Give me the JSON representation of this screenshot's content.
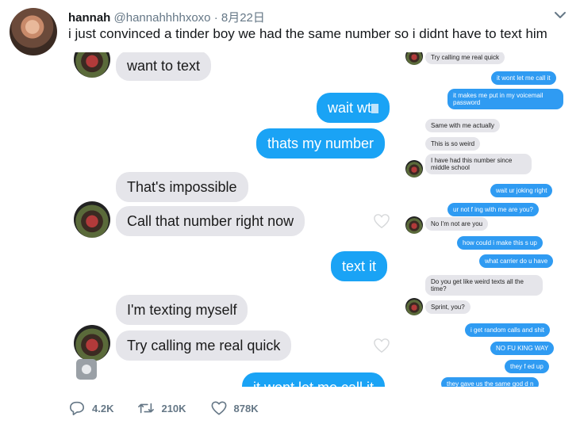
{
  "tweet": {
    "display_name": "hannah",
    "handle": "@hannahhhhxoxo",
    "separator": "·",
    "date": "8月22日",
    "text": "i just convinced a tinder boy we had the same number so i didnt have to text him"
  },
  "left_chat": [
    {
      "dir": "in",
      "text": "want to text"
    },
    {
      "dir": "out",
      "text": "wait wt"
    },
    {
      "dir": "out",
      "text": "thats my number"
    },
    {
      "dir": "in",
      "text": "That's impossible"
    },
    {
      "dir": "in",
      "text": "Call that number right now"
    },
    {
      "dir": "out",
      "text": "text it"
    },
    {
      "dir": "in",
      "text": "I'm texting myself"
    },
    {
      "dir": "in",
      "text": "Try calling me real quick"
    },
    {
      "dir": "out",
      "text": "it wont let me call it"
    }
  ],
  "right_chat": [
    {
      "dir": "in",
      "text": "Try calling me real quick"
    },
    {
      "dir": "out",
      "text": "it wont let me call it"
    },
    {
      "dir": "out",
      "text": "it makes me put in my voicemail password"
    },
    {
      "dir": "in",
      "text": "Same with me actually"
    },
    {
      "dir": "in",
      "text": "This is so weird"
    },
    {
      "dir": "in",
      "text": "I have had this number since middle school"
    },
    {
      "dir": "out",
      "text": "wait ur joking right"
    },
    {
      "dir": "out",
      "text": "ur not f   ing with me are you?"
    },
    {
      "dir": "in",
      "text": "No I'm not are you"
    },
    {
      "dir": "out",
      "text": "how could i make this s   up"
    },
    {
      "dir": "out",
      "text": "what carrier do u have"
    },
    {
      "dir": "in",
      "text": "Do you get like weird texts all the time?"
    },
    {
      "dir": "in",
      "text": "Sprint, you?"
    },
    {
      "dir": "out",
      "text": "i get random calls and shit"
    },
    {
      "dir": "out",
      "text": "NO FU   KING WAY"
    },
    {
      "dir": "out",
      "text": "they f   ed up"
    },
    {
      "dir": "out",
      "text": "they gave us the same god d   n"
    }
  ],
  "actions": {
    "replies": "4.2K",
    "retweets": "210K",
    "likes": "878K"
  },
  "icons": {
    "menu": "chevron-down-icon",
    "reply": "reply-icon",
    "retweet": "retweet-icon",
    "like": "heart-icon"
  },
  "colors": {
    "imessage_blue": "#1aa3f5",
    "gray_bubble": "#e5e5ea",
    "secondary_text": "#657786"
  }
}
